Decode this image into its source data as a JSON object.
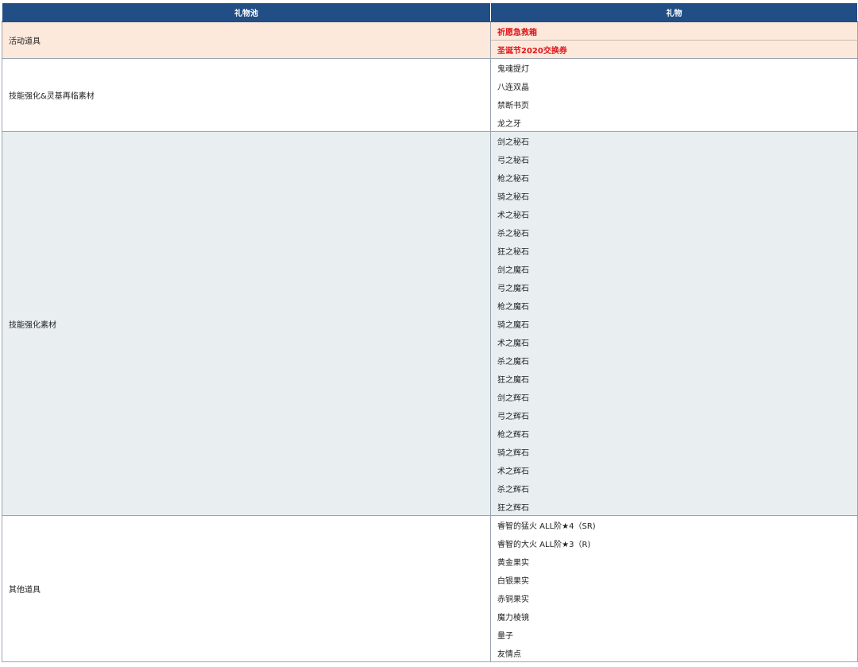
{
  "table": {
    "headers": {
      "pool": "礼物池",
      "gift": "礼物"
    },
    "groups": [
      {
        "pool": "活动道具",
        "items": [
          "祈愿急救箱",
          "圣诞节2020交换券"
        ]
      },
      {
        "pool": "技能强化&灵基再临素材",
        "items": [
          "鬼魂提灯",
          "八连双晶",
          "禁断书页",
          "龙之牙"
        ]
      },
      {
        "pool": "技能强化素材",
        "items": [
          "剑之秘石",
          "弓之秘石",
          "枪之秘石",
          "骑之秘石",
          "术之秘石",
          "杀之秘石",
          "狂之秘石",
          "剑之魔石",
          "弓之魔石",
          "枪之魔石",
          "骑之魔石",
          "术之魔石",
          "杀之魔石",
          "狂之魔石",
          "剑之辉石",
          "弓之辉石",
          "枪之辉石",
          "骑之辉石",
          "术之辉石",
          "杀之辉石",
          "狂之辉石"
        ]
      },
      {
        "pool": "其他道具",
        "items": [
          "睿智的猛火 ALL阶★4（SR)",
          "睿智的大火 ALL阶★3（R)",
          "黄金果实",
          "白银果实",
          "赤铜果实",
          "魔力棱镜",
          "量子",
          "友情点"
        ]
      }
    ]
  },
  "colors": {
    "header_bg": "#224e86",
    "event_bg": "#fde9dc",
    "event_text": "#e0141a",
    "stone_bg": "#e9eff1"
  }
}
